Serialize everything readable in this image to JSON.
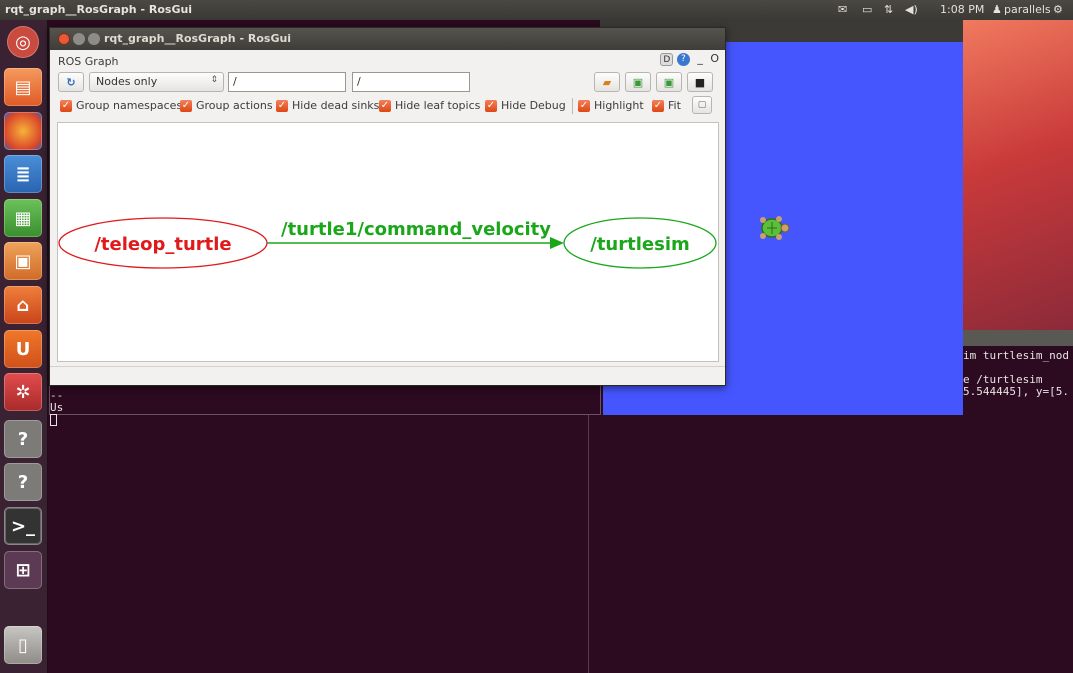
{
  "top_panel": {
    "title": "rqt_graph__RosGraph - RosGui",
    "time": "1:08 PM",
    "user": "parallels",
    "colors": {
      "background": "#3f3e3a",
      "text": "#dfdbd2"
    },
    "icons": [
      "mail-icon",
      "battery-icon",
      "network-icon",
      "volume-icon",
      "user-icon",
      "gear-icon"
    ]
  },
  "launcher": {
    "icons": [
      "ubuntu-dash-icon",
      "files-icon",
      "firefox-icon",
      "writer-icon",
      "calc-icon",
      "impress-icon",
      "software-center-icon",
      "ubuntu-one-icon",
      "settings-icon",
      "unknown-app-icon",
      "unknown-app-icon",
      "terminal-icon",
      "workspace-switcher-icon",
      "trash-icon"
    ],
    "unknown_glyph": "?"
  },
  "rqt": {
    "title": "rqt_graph__RosGraph - RosGui",
    "plugin_label": "ROS Graph",
    "plugin_ctrl_min": "_",
    "plugin_ctrl_close": "O",
    "plugin_ctrl_d": "D",
    "plugin_ctrl_help": "?",
    "toolbar": {
      "mode": "Nodes only",
      "filter_namespace": "/",
      "filter_topic": "/"
    },
    "checkboxes": [
      {
        "label": "Group namespaces",
        "checked": true
      },
      {
        "label": "Group actions",
        "checked": true
      },
      {
        "label": "Hide dead sinks",
        "checked": true
      },
      {
        "label": "Hide leaf topics",
        "checked": true
      },
      {
        "label": "Hide Debug",
        "checked": true
      },
      {
        "label": "Highlight",
        "checked": true
      },
      {
        "label": "Fit",
        "checked": true
      }
    ],
    "graph": {
      "source_node": "/teleop_turtle",
      "edge_label": "/turtle1/command_velocity",
      "target_node": "/turtlesim",
      "colors": {
        "source": "#e0191b",
        "edge": "#1aa71a",
        "target": "#1aa71a"
      }
    }
  },
  "terminal_left": {
    "lines": [
      "--",
      "Us"
    ]
  },
  "terminal_right": {
    "lines": [
      "im turtlesim_nod",
      "",
      "e /turtlesim",
      "5.544445], y=[5."
    ]
  },
  "turtlesim": {
    "background": "#4556ff"
  }
}
